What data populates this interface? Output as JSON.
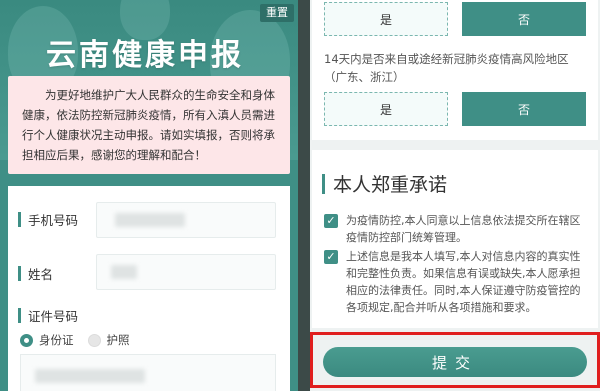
{
  "header": {
    "title": "云南健康申报",
    "reset_label": "重置"
  },
  "notice": {
    "text": "为更好地维护广大人民群众的生命安全和身体健康，依法防控新冠肺炎疫情，所有入滇人员需进行个人健康状况主动申报。请如实填报，否则将承担相应后果，感谢您的理解和配合！"
  },
  "form": {
    "phone_label": "手机号码",
    "name_label": "姓名",
    "id_label": "证件号码",
    "id_type_options": [
      "身份证",
      "护照"
    ],
    "id_type_selected": "身份证"
  },
  "questions": [
    {
      "text": "",
      "yes": "是",
      "no": "否",
      "selected": "否"
    },
    {
      "text": "14天内是否来自或途经新冠肺炎疫情高风险地区（广东、浙江）",
      "yes": "是",
      "no": "否",
      "selected": "否"
    }
  ],
  "pledge": {
    "title": "本人郑重承诺",
    "items": [
      {
        "checked": true,
        "text": "为疫情防控,本人同意以上信息依法提交所在辖区疫情防控部门统筹管理。"
      },
      {
        "checked": true,
        "text": "上述信息是我本人填写,本人对信息内容的真实性和完整性负责。如果信息有误或缺失,本人愿承担相应的法律责任。同时,本人保证遵守防疫管控的各项规定,配合并听从各项措施和要求。"
      }
    ]
  },
  "submit_label": "提交",
  "colors": {
    "accent": "#3f8f86",
    "notice_bg": "#fde6e8",
    "highlight": "#e01f1f"
  },
  "icons": {
    "check": "checkbox-checked-icon",
    "radio_on": "radio-selected-icon",
    "radio_off": "radio-unselected-icon"
  }
}
